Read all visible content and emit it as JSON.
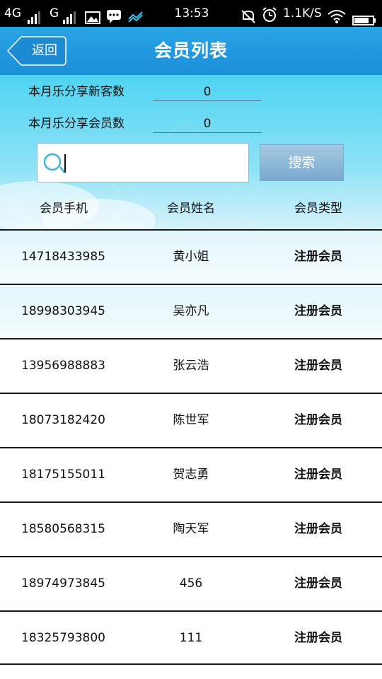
{
  "status_bar": {
    "net1": "4G",
    "net2": "G",
    "time": "13:53",
    "speed": "1.1K/S",
    "icons": [
      "signal-icon",
      "image-icon",
      "message-icon",
      "chart-icon",
      "mute-icon",
      "alarm-icon",
      "wifi-icon",
      "battery-icon"
    ]
  },
  "header": {
    "back_label": "返回",
    "title": "会员列表",
    "color": "#1b8fd8"
  },
  "stats": [
    {
      "label": "本月乐分享新客数",
      "value": "0"
    },
    {
      "label": "本月乐分享会员数",
      "value": "0"
    }
  ],
  "search": {
    "placeholder": "",
    "button_label": "搜索"
  },
  "table": {
    "columns": [
      "会员手机",
      "会员姓名",
      "会员类型"
    ],
    "rows": [
      {
        "phone": "14718433985",
        "name": "黄小姐",
        "type": "注册会员"
      },
      {
        "phone": "18998303945",
        "name": "吴亦凡",
        "type": "注册会员"
      },
      {
        "phone": "13956988883",
        "name": "张云浩",
        "type": "注册会员"
      },
      {
        "phone": "18073182420",
        "name": "陈世军",
        "type": "注册会员"
      },
      {
        "phone": "18175155011",
        "name": "贺志勇",
        "type": "注册会员"
      },
      {
        "phone": "18580568315",
        "name": "陶天军",
        "type": "注册会员"
      },
      {
        "phone": "18974973845",
        "name": "456",
        "type": "注册会员"
      },
      {
        "phone": "18325793800",
        "name": "111",
        "type": "注册会员"
      }
    ]
  }
}
